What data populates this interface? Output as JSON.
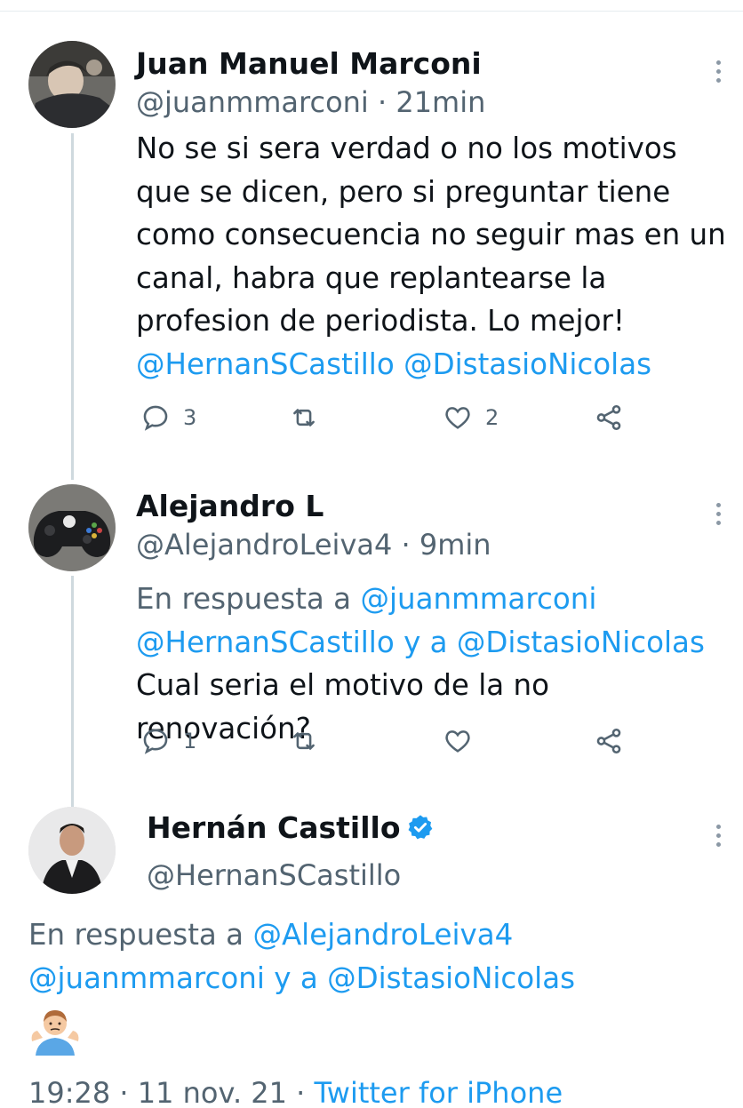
{
  "tweets": [
    {
      "name": "Juan Manuel Marconi",
      "handle": "@juanmmarconi",
      "separator": "·",
      "time": "21min",
      "text": "No se si sera verdad o no los motivos que se dicen, pero si preguntar tiene como consecuencia no seguir mas en un canal, habra que replantearse la profesion de periodista. Lo mejor!",
      "text_lines": [
        "No se si sera verdad o no los motivos",
        "que se dicen, pero si preguntar tiene",
        "como consecuencia no seguir mas en un",
        "canal, habra que replantearse la",
        "profesion de periodista. Lo mejor!"
      ],
      "mention_1": "@HernanSCastillo",
      "mention_2": "@DistasioNicolas",
      "reply_count": "3",
      "retweet_count": "",
      "like_count": "2"
    },
    {
      "name": "Alejandro L",
      "handle": "@AlejandroLeiva4",
      "separator": "·",
      "time": "9min",
      "reply_prefix": "En respuesta a",
      "reply_mention_1": "@juanmmarconi",
      "reply_mention_2": "@HernanSCastillo",
      "reply_and": "y a",
      "reply_mention_3": "@DistasioNicolas",
      "text": "Cual seria el motivo de la no renovación?",
      "reply_count": "1",
      "retweet_count": "",
      "like_count": ""
    },
    {
      "name": "Hernán Castillo",
      "verified": true,
      "handle": "@HernanSCastillo",
      "reply_prefix": "En respuesta a",
      "reply_mention_1": "@AlejandroLeiva4",
      "reply_mention_2": "@juanmmarconi",
      "reply_and": "y a",
      "reply_mention_3": "@DistasioNicolas",
      "emoji": "person-shrugging-emoji",
      "timestamp_time": "19:28",
      "timestamp_date": "11 nov. 21",
      "separator": "·",
      "source": "Twitter for iPhone"
    }
  ],
  "icons": {
    "reply": "reply-icon",
    "retweet": "retweet-icon",
    "like": "heart-icon",
    "share": "share-icon",
    "more": "more-dots-icon",
    "verified": "verified-badge-icon"
  },
  "colors": {
    "link": "#1d9bf0",
    "text": "#0f1419",
    "secondary": "#536471",
    "thread_line": "#cfd9de",
    "verified": "#1d9bf0"
  }
}
